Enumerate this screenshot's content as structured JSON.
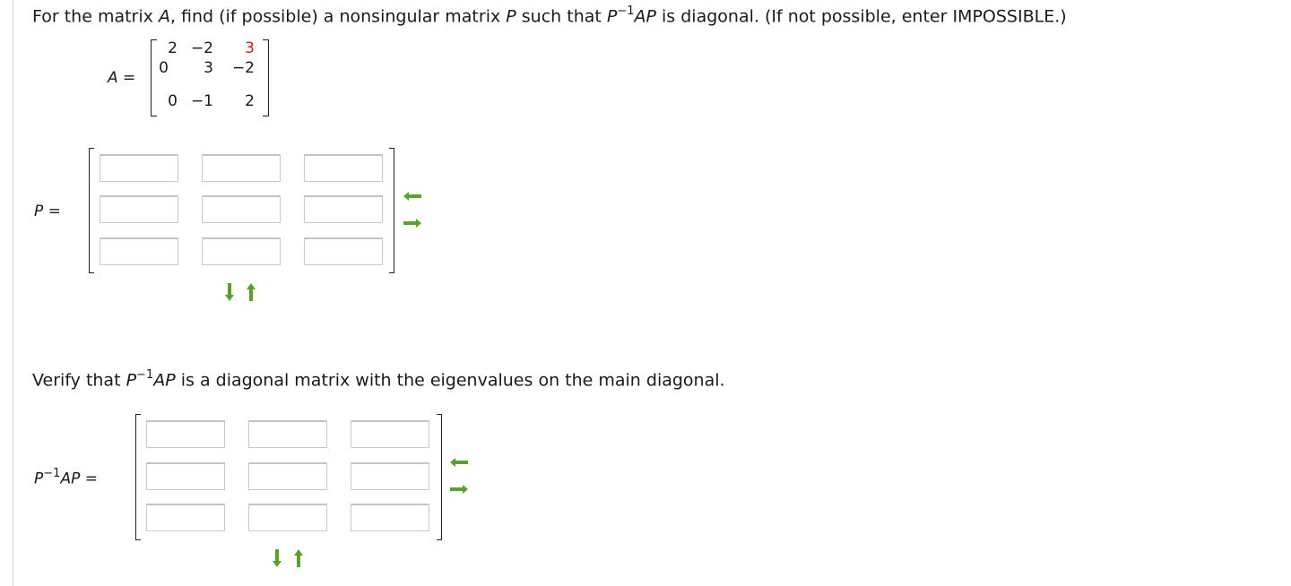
{
  "question": {
    "part1": "For the matrix ",
    "var_a": "A",
    "part2": ", find (if possible) a nonsingular matrix ",
    "var_p": "P",
    "part3": " such that ",
    "p": "P",
    "exp": "−1",
    "ap": "AP",
    "part4": " is diagonal. (If not possible, enter IMPOSSIBLE.)"
  },
  "matrix_a": {
    "label": "A =",
    "rows": [
      [
        "2",
        "−2",
        "3"
      ],
      [
        "0",
        "3",
        "−2"
      ],
      [
        "0",
        "−1",
        "2"
      ]
    ],
    "highlight_color": "#d01818"
  },
  "matrix_p": {
    "label": "P ="
  },
  "verify": {
    "part1": "Verify that ",
    "p": "P",
    "exp": "−1",
    "ap": "AP",
    "part2": " is a diagonal matrix with the eigenvalues on the main diagonal."
  },
  "matrix_d": {
    "label_p": "P",
    "label_exp": "−1",
    "label_ap": "AP",
    "label_eq": " ="
  },
  "icons": {
    "remove_column": "left-arrow-icon",
    "add_column": "right-arrow-icon",
    "add_row": "down-arrow-icon",
    "remove_row": "up-arrow-icon",
    "color": "#5aa02c"
  }
}
